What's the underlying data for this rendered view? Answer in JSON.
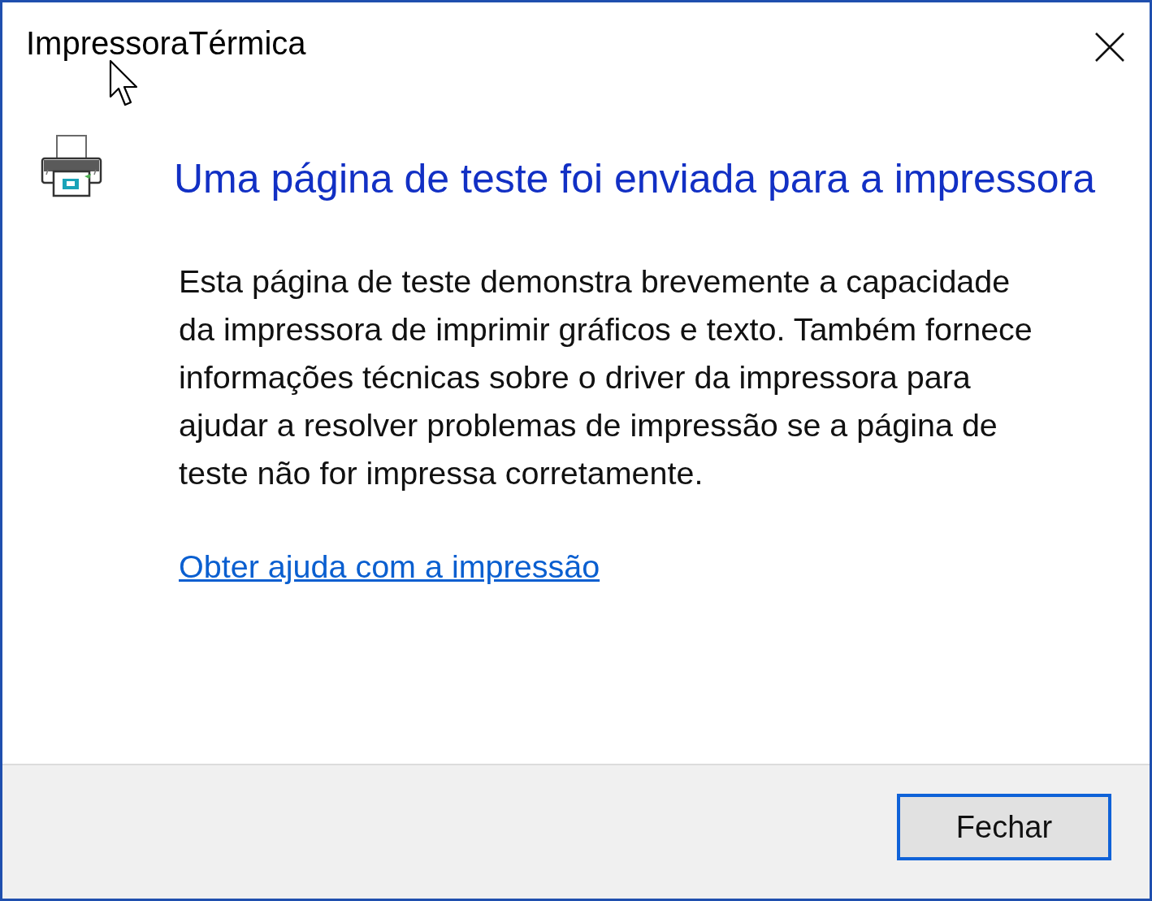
{
  "window": {
    "title": "ImpressoraTérmica"
  },
  "dialog": {
    "heading": "Uma página de teste foi enviada para a impressora",
    "body": "Esta página de teste demonstra brevemente a capacidade da impressora de imprimir gráficos e texto. Também fornece informações técnicas sobre o driver da impressora para ajudar a resolver problemas de impressão se a página de teste não for impressa corretamente.",
    "link": "Obter ajuda com a impressão"
  },
  "footer": {
    "buttons": [
      {
        "label": "Fechar",
        "focused": true
      }
    ]
  }
}
